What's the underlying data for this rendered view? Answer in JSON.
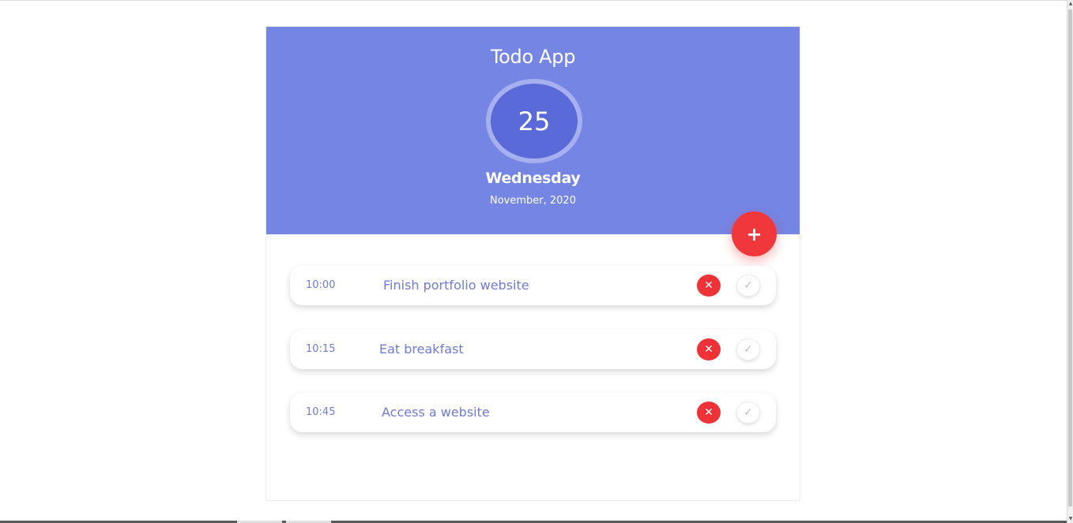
{
  "app": {
    "title": "Todo App",
    "day_number": "25",
    "weekday": "Wednesday",
    "month_year": "November, 2020",
    "add_label": "+"
  },
  "todos": [
    {
      "time": "10:00",
      "text": "Finish portfolio website",
      "delete_icon": "✕",
      "done_icon": "✓"
    },
    {
      "time": "10:15",
      "text": "Eat breakfast",
      "delete_icon": "✕",
      "done_icon": "✓"
    },
    {
      "time": "10:45",
      "text": "Access a website",
      "delete_icon": "✕",
      "done_icon": "✓"
    }
  ],
  "colors": {
    "header": "#7585e3",
    "circle": "#5a6ad9",
    "accent_red": "#f0373b",
    "text_blue": "#6f7bd6"
  },
  "scroll": {
    "up_arrow": "▲",
    "down_arrow": "▼"
  }
}
